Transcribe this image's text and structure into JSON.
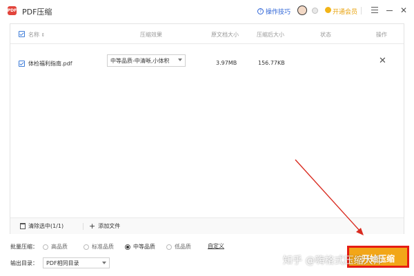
{
  "app": {
    "logo": "PDF",
    "title": "PDF压缩"
  },
  "titlebar": {
    "tips_label": "操作技巧",
    "vip_label": "开通会员",
    "icons": [
      "question-icon",
      "avatar",
      "gray-circle-icon",
      "vip-crown-icon",
      "menu-icon",
      "minimize-icon",
      "close-icon"
    ]
  },
  "table": {
    "headers": {
      "name": "名称",
      "effect": "压缩效果",
      "orig_size": "原文档大小",
      "new_size": "压缩后大小",
      "status": "状态",
      "action": "操作"
    },
    "rows": [
      {
        "checked": true,
        "name": "体检福利指南.pdf",
        "effect": "中等品质-中清晰,小体积",
        "orig_size": "3.97MB",
        "new_size": "156.77KB",
        "status": "",
        "action": "✕"
      }
    ]
  },
  "panel_footer": {
    "clear_label": "清除选中(1/1)",
    "add_label": "添加文件"
  },
  "batch": {
    "label": "批量压缩：",
    "options": [
      "高品质",
      "标准品质",
      "中等品质",
      "低品质"
    ],
    "selected": "中等品质",
    "custom_label": "自定义"
  },
  "output": {
    "label": "输出目录：",
    "value": "PDF相同目录"
  },
  "start_button": {
    "label": "开始压缩"
  },
  "watermark": "知乎 @嗨格式压缩大师",
  "colors": {
    "accent": "#3c7bd8",
    "button": "#f2a618",
    "highlight": "#e51c14",
    "vip": "#e8a20c"
  }
}
